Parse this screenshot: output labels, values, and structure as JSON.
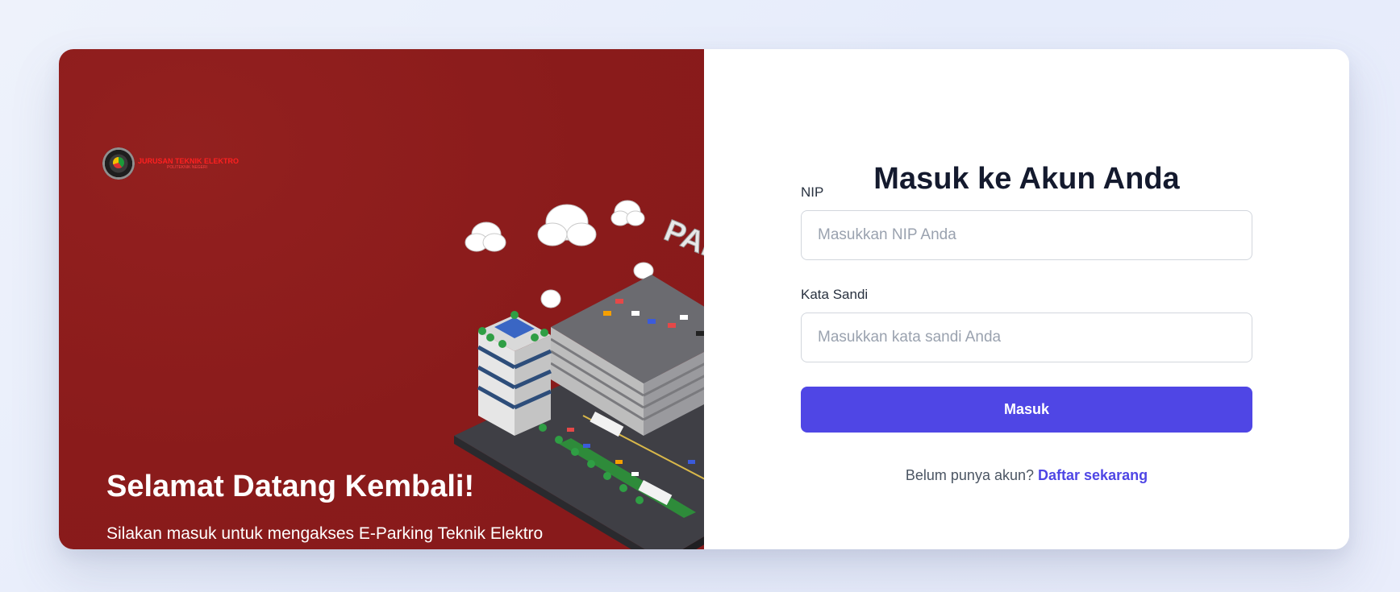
{
  "branding": {
    "logo_text": "JURUSAN TEKNIK ELEKTRO",
    "logo_subtext": "POLITEKNIK NEGERI",
    "illustration_label": "PARKING"
  },
  "hero": {
    "title": "Selamat Datang Kembali!",
    "subtitle": "Silakan masuk untuk mengakses E-Parking Teknik Elektro"
  },
  "form": {
    "title": "Masuk ke Akun Anda",
    "nip_label": "NIP",
    "nip_placeholder": "Masukkan NIP Anda",
    "nip_value": "",
    "password_label": "Kata Sandi",
    "password_placeholder": "Masukkan kata sandi Anda",
    "password_value": "",
    "submit_label": "Masuk"
  },
  "footer": {
    "prompt": "Belum punya akun?",
    "link_label": "Daftar sekarang"
  },
  "colors": {
    "hero_bg": "#8b1c1c",
    "accent": "#4f46e5",
    "title": "#141a2e"
  }
}
